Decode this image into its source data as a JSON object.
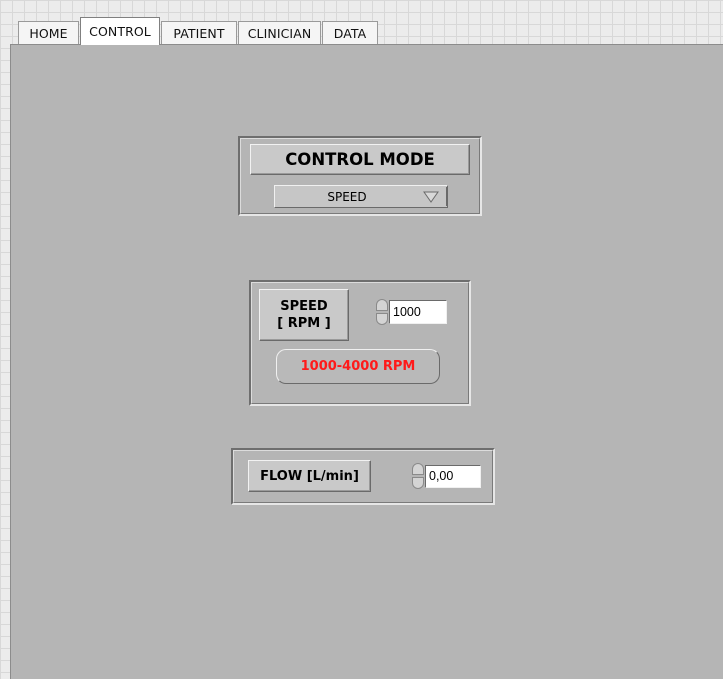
{
  "tabs": [
    {
      "label": "HOME"
    },
    {
      "label": "CONTROL"
    },
    {
      "label": "PATIENT"
    },
    {
      "label": "CLINICIAN"
    },
    {
      "label": "DATA"
    }
  ],
  "active_tab": "CONTROL",
  "control_mode": {
    "title": "CONTROL MODE",
    "selected": "SPEED"
  },
  "speed": {
    "label_line1": "SPEED",
    "label_line2": "[ RPM ]",
    "value": "1000",
    "range_text": "1000-4000 RPM"
  },
  "flow": {
    "label": "FLOW [L/min]",
    "value": "0,00"
  },
  "colors": {
    "panel": "#b5b5b5",
    "range_text": "#ff1a1a"
  }
}
